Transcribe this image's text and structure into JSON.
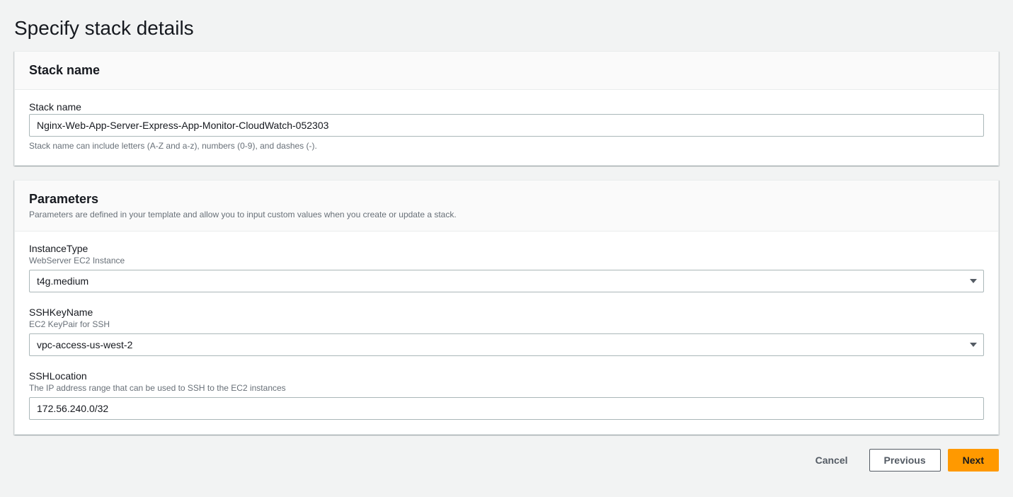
{
  "page": {
    "title": "Specify stack details"
  },
  "stackName": {
    "panelTitle": "Stack name",
    "fieldLabel": "Stack name",
    "value": "Nginx-Web-App-Server-Express-App-Monitor-CloudWatch-052303",
    "hint": "Stack name can include letters (A-Z and a-z), numbers (0-9), and dashes (-)."
  },
  "parameters": {
    "panelTitle": "Parameters",
    "panelSubtitle": "Parameters are defined in your template and allow you to input custom values when you create or update a stack.",
    "instanceType": {
      "label": "InstanceType",
      "hint": "WebServer EC2 Instance",
      "value": "t4g.medium"
    },
    "sshKeyName": {
      "label": "SSHKeyName",
      "hint": "EC2 KeyPair for SSH",
      "value": "vpc-access-us-west-2"
    },
    "sshLocation": {
      "label": "SSHLocation",
      "hint": "The IP address range that can be used to SSH to the EC2 instances",
      "value": "172.56.240.0/32"
    }
  },
  "buttons": {
    "cancel": "Cancel",
    "previous": "Previous",
    "next": "Next"
  }
}
